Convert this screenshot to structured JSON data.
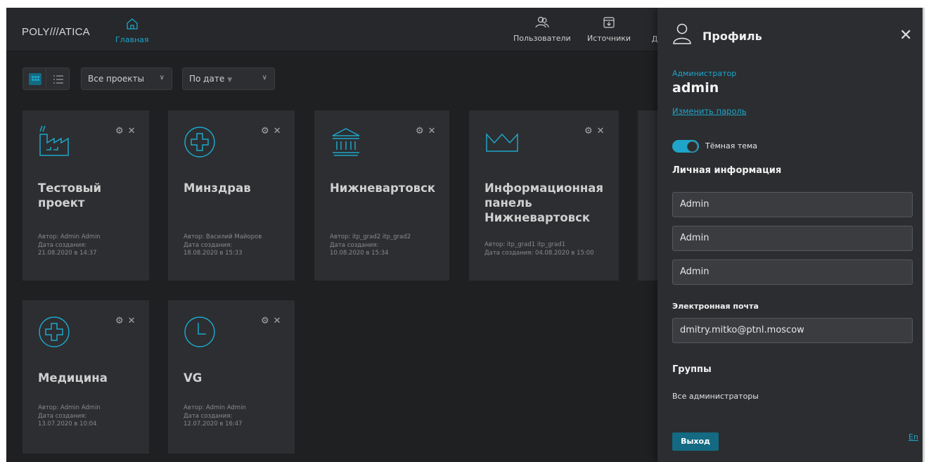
{
  "app": {
    "logo": "POLY///ATICA"
  },
  "nav": {
    "home": "Главная",
    "users": "Пользователи",
    "sources": "Источники",
    "more": "Д"
  },
  "toolbar": {
    "project_filter": "Все проекты",
    "sort": "По дате",
    "sort_arrow": "▼",
    "chevron": "∨"
  },
  "cards": [
    {
      "title_line1": "Тестовый",
      "title_line2": "проект",
      "author": "Автор: Admin Admin",
      "date_label": "Дата создания:",
      "date": "21.08.2020 в 14:37",
      "icon": "factory-icon"
    },
    {
      "title_line1": "Минздрав",
      "author": "Автор: Василий Майоров",
      "date_label": "Дата создания:",
      "date": "18.08.2020 в 15:33",
      "icon": "medical-cross-icon"
    },
    {
      "title_line1": "Нижневартовск",
      "author": "Автор: itp_grad2 itp_grad2",
      "date_label": "Дата создания:",
      "date": "10.08.2020 в 15:34",
      "icon": "government-building-icon"
    },
    {
      "title_line1": "Информационная",
      "title_line2": "панель",
      "title_line3": "Нижневартовск",
      "author": "Автор: itp_grad1 itp_grad1",
      "date_full": "Дата создания: 04.08.2020 в 15:00",
      "icon": "crown-icon"
    },
    {
      "title_line1": "Медицина",
      "author": "Автор: Admin Admin",
      "date_label": "Дата создания:",
      "date": "13.07.2020 в 10:04",
      "icon": "medical-cross-icon"
    },
    {
      "title_line1": "VG",
      "author": "Автор: Admin Admin",
      "date_label": "Дата создания:",
      "date": "12.07.2020 в 16:47",
      "icon": "clock-icon"
    }
  ],
  "card_actions": {
    "settings": "⚙",
    "close": "✕"
  },
  "profile": {
    "title": "Профиль",
    "close": "✕",
    "role": "Администратор",
    "login": "admin",
    "change_password": "Изменить пароль",
    "dark_theme_label": "Тёмная тема",
    "dark_theme_on": true,
    "personal_info": "Личная информация",
    "fields": [
      "Admin",
      "Admin",
      "Admin"
    ],
    "email_label": "Электронная почта",
    "email": "dmitry.mitko@ptnl.moscow",
    "groups_label": "Группы",
    "group": "Все администраторы",
    "logout": "Выход",
    "lang": "En"
  },
  "colors": {
    "accent": "#1ea5c9",
    "button": "#146a82",
    "bg": "#1f2022",
    "card": "#2c2e31",
    "panel": "#2b2d30"
  }
}
